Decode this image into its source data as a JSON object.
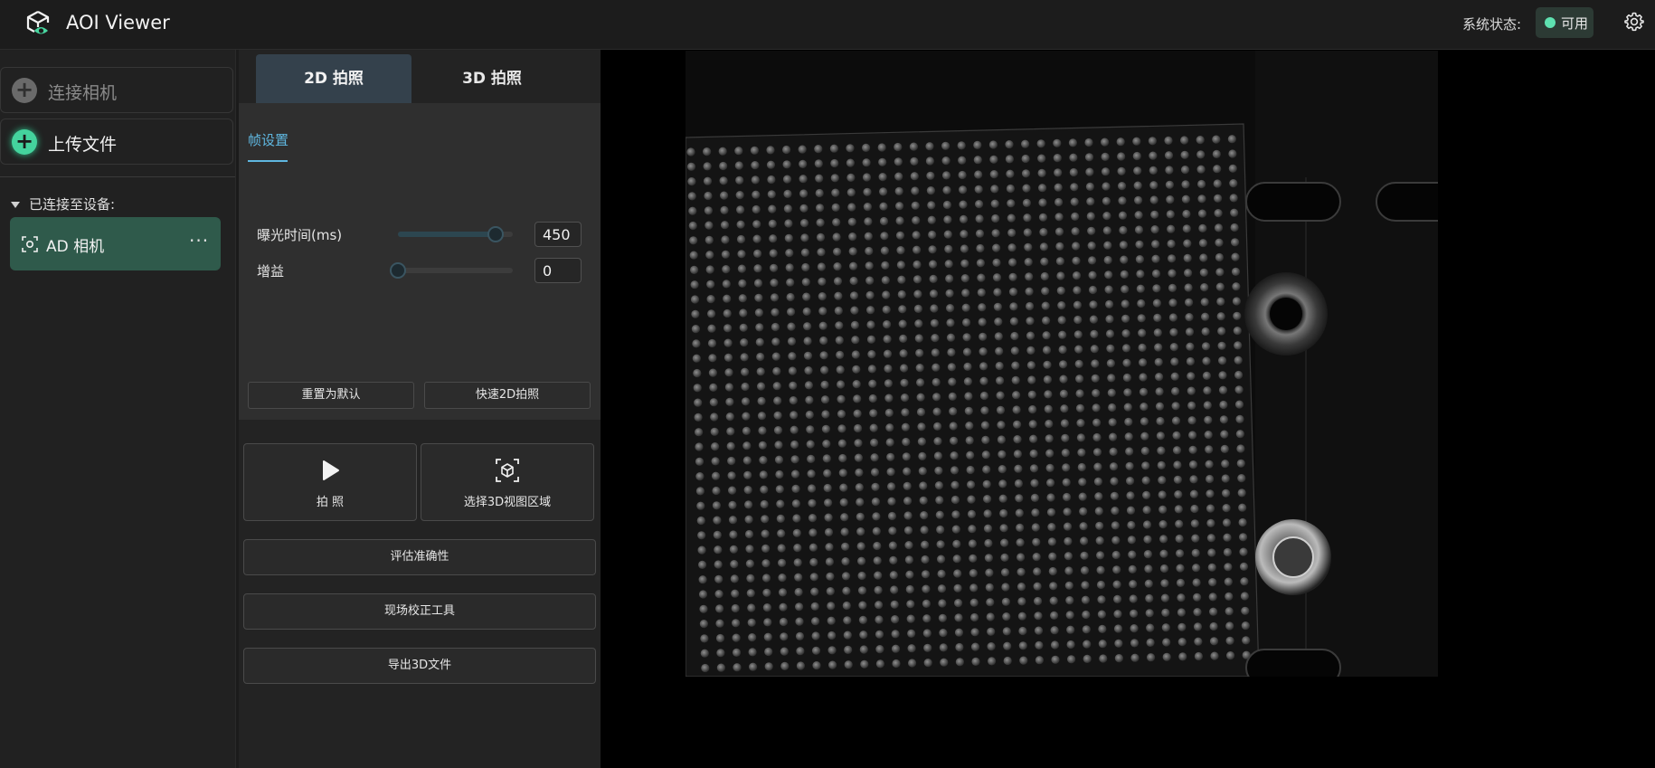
{
  "app": {
    "title": "AOI Viewer"
  },
  "header": {
    "status_label": "系统状态:",
    "status_value": "可用",
    "status_color": "#5ee1b0",
    "settings_icon": "gear-icon",
    "logo_icon": "cube-eye-icon"
  },
  "sidebar": {
    "connect_camera": "连接相机",
    "upload_file": "上传文件",
    "connected_header": "已连接至设备:",
    "devices": [
      {
        "name": "AD 相机",
        "more": "···",
        "icon": "focus-camera-icon"
      }
    ]
  },
  "panel": {
    "tabs": [
      {
        "label": "2D 拍照",
        "active": true
      },
      {
        "label": "3D 拍照",
        "active": false
      }
    ],
    "subtab": "帧设置",
    "params": [
      {
        "label": "曝光时间(ms)",
        "value": "450",
        "fraction": 0.85
      },
      {
        "label": "增益",
        "value": "0",
        "fraction": 0.0
      }
    ],
    "reset_button": "重置为默认",
    "quick_2d_button": "快速2D拍照",
    "capture_button": "拍 照",
    "select_3d_button": "选择3D视图区域",
    "evaluate_button": "评估准确性",
    "calibration_button": "现场校正工具",
    "export_button": "导出3D文件"
  },
  "colors": {
    "accent": "#5fb7e0",
    "green": "#44d39d",
    "active_device_bg": "#2f5a4b",
    "active_tab_bg": "#34414c"
  }
}
